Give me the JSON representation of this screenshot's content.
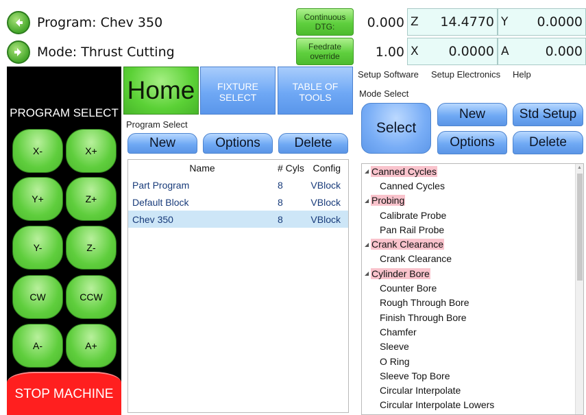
{
  "header": {
    "program_label": "Program: Chev 350",
    "mode_label": "Mode: Thrust Cutting",
    "continuous_btn": "Continuous DTG:",
    "feedrate_btn": "Feedrate override",
    "dtg_value": "0.000",
    "feedrate_value": "1.00",
    "axes": {
      "z": {
        "letter": "Z",
        "value": "14.4770"
      },
      "y": {
        "letter": "Y",
        "value": "0.0000"
      },
      "x": {
        "letter": "X",
        "value": "0.0000"
      },
      "a": {
        "letter": "A",
        "value": "0.000"
      }
    }
  },
  "jog": {
    "title": "PROGRAM SELECT",
    "buttons": [
      "X-",
      "X+",
      "Y+",
      "Z+",
      "Y-",
      "Z-",
      "CW",
      "CCW",
      "A-",
      "A+"
    ],
    "stop": "STOP MACHINE"
  },
  "tabs": {
    "home": "Home",
    "fixture": "FIXTURE SELECT",
    "tools": "TABLE OF TOOLS"
  },
  "program_select": {
    "label": "Program Select",
    "new": "New",
    "options": "Options",
    "delete": "Delete",
    "columns": [
      "Name",
      "# Cyls",
      "Config"
    ],
    "rows": [
      {
        "name": "Part Program",
        "cyls": "8",
        "config": "VBlock"
      },
      {
        "name": "Default Block",
        "cyls": "8",
        "config": "VBlock"
      },
      {
        "name": "Chev 350",
        "cyls": "8",
        "config": "VBlock"
      }
    ]
  },
  "menu": {
    "setup_software": "Setup Software",
    "setup_electronics": "Setup Electronics",
    "help": "Help"
  },
  "mode_select": {
    "label": "Mode Select",
    "select": "Select",
    "new": "New",
    "std_setup": "Std Setup",
    "options": "Options",
    "delete": "Delete",
    "tree": [
      {
        "category": "Canned Cycles",
        "items": [
          "Canned Cycles"
        ]
      },
      {
        "category": "Probing",
        "items": [
          "Calibrate Probe",
          "Pan Rail Probe"
        ]
      },
      {
        "category": "Crank Clearance",
        "items": [
          "Crank Clearance"
        ]
      },
      {
        "category": "Cylinder Bore",
        "items": [
          "Counter Bore",
          "Rough Through Bore",
          "Finish Through Bore",
          "Chamfer",
          "Sleeve",
          "O Ring",
          "Sleeve Top Bore",
          "Circular Interpolate",
          "Circular Interpolate Lowers"
        ]
      }
    ]
  },
  "colors": {
    "green": "#5fcf3e",
    "blue": "#6fa9f4",
    "stop_red": "#ff1f1f",
    "highlight_pink": "#f9c3cc",
    "selected_row": "#cde6f7",
    "axis_bg": "#e8fbf8"
  }
}
